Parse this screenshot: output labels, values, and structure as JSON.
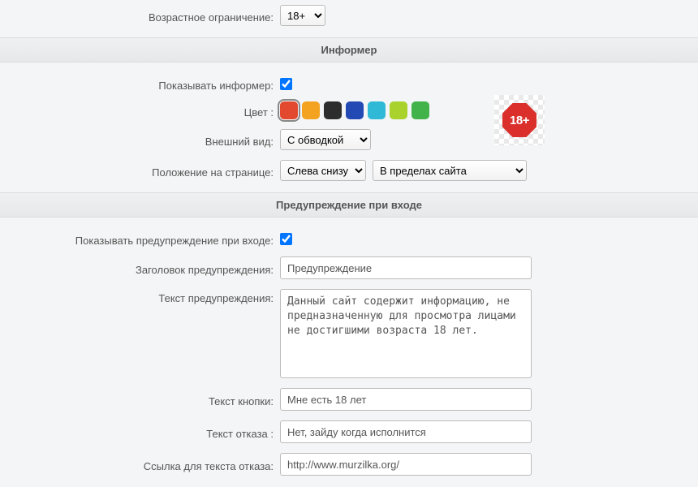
{
  "age": {
    "label": "Возрастное ограничение:",
    "value": "18+"
  },
  "informer": {
    "header": "Информер",
    "show_label": "Показывать информер:",
    "show_checked": true,
    "color_label": "Цвет :",
    "colors": {
      "c0": "#e2492f",
      "c1": "#f4a321",
      "c2": "#2d2d2d",
      "c3": "#2349b5",
      "c4": "#2fb9d6",
      "c5": "#a9d22d",
      "c6": "#42b34a"
    },
    "appearance_label": "Внешний вид:",
    "appearance_value": "С обводкой",
    "position_label": "Положение на странице:",
    "position_value": "Слева снизу",
    "position_scope_value": "В пределах сайта",
    "preview_badge": "18+"
  },
  "warning": {
    "header": "Предупреждение при входе",
    "show_label": "Показывать предупреждение при входе:",
    "show_checked": true,
    "title_label": "Заголовок предупреждения:",
    "title_value": "Предупреждение",
    "text_label": "Текст предупреждения:",
    "text_value": "Данный сайт содержит информацию, не предназначенную для просмотра лицами не достигшими возраста 18 лет.",
    "button_label": "Текст кнопки:",
    "button_value": "Мне есть 18 лет",
    "reject_label": "Текст отказа :",
    "reject_value": "Нет, зайду когда исполнится",
    "reject_link_label": "Ссылка для текста отказа:",
    "reject_link_value": "http://www.murzilka.org/"
  }
}
